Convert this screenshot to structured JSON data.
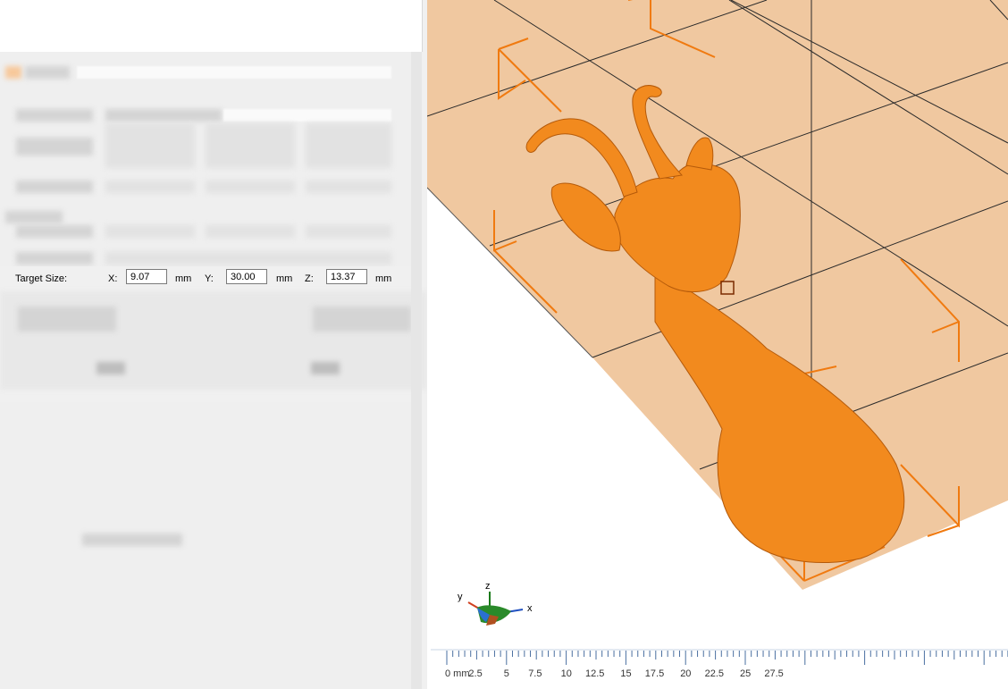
{
  "target_size": {
    "label": "Target Size:",
    "x_label": "X:",
    "x_value": "9.07",
    "y_label": "Y:",
    "y_value": "30.00",
    "z_label": "Z:",
    "z_value": "13.37",
    "unit": "mm"
  },
  "ruler": {
    "ticks": [
      "0 mm",
      "2.5",
      "5",
      "7.5",
      "10",
      "12.5",
      "15",
      "17.5",
      "20",
      "22.5",
      "25",
      "27.5"
    ]
  },
  "axis_gizmo": {
    "x": "x",
    "y": "y",
    "z": "z"
  },
  "colors": {
    "build_plate": "#f0c8a0",
    "model": "#f28a1e",
    "bounding_box": "#f07a10",
    "background": "#ffffff"
  },
  "icons": [
    "axis-gizmo-icon",
    "model-3d-goat-head"
  ]
}
